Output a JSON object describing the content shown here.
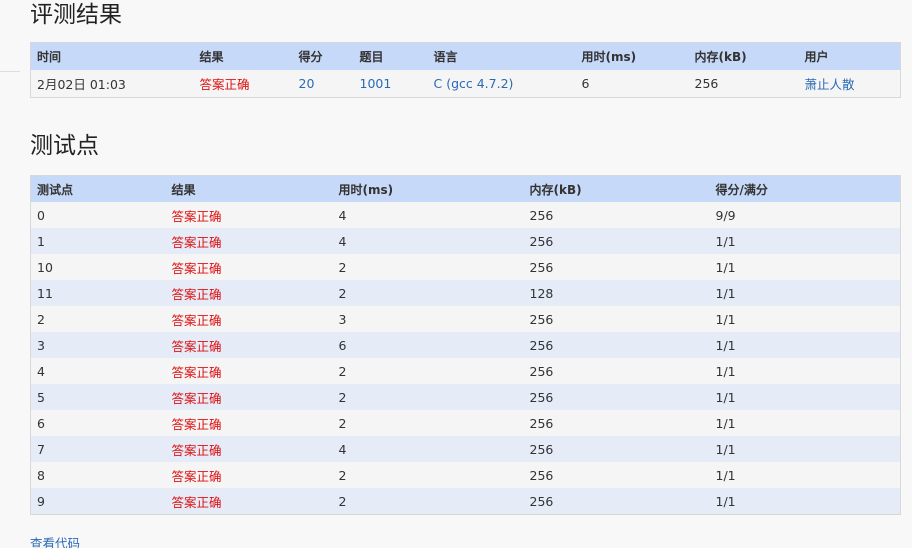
{
  "result_title": "评测结果",
  "summary": {
    "headers": [
      "时间",
      "结果",
      "得分",
      "题目",
      "语言",
      "用时(ms)",
      "内存(kB)",
      "用户"
    ],
    "row": {
      "time": "2月02日 01:03",
      "result": "答案正确",
      "score": "20",
      "problem": "1001",
      "language": "C (gcc 4.7.2)",
      "time_ms": "6",
      "memory_kb": "256",
      "user": "萧止人散"
    }
  },
  "cases_title": "测试点",
  "cases": {
    "headers": [
      "测试点",
      "结果",
      "用时(ms)",
      "内存(kB)",
      "得分/满分"
    ],
    "rows": [
      {
        "id": "0",
        "result": "答案正确",
        "time": "4",
        "memory": "256",
        "score": "9/9"
      },
      {
        "id": "1",
        "result": "答案正确",
        "time": "4",
        "memory": "256",
        "score": "1/1"
      },
      {
        "id": "10",
        "result": "答案正确",
        "time": "2",
        "memory": "256",
        "score": "1/1"
      },
      {
        "id": "11",
        "result": "答案正确",
        "time": "2",
        "memory": "128",
        "score": "1/1"
      },
      {
        "id": "2",
        "result": "答案正确",
        "time": "3",
        "memory": "256",
        "score": "1/1"
      },
      {
        "id": "3",
        "result": "答案正确",
        "time": "6",
        "memory": "256",
        "score": "1/1"
      },
      {
        "id": "4",
        "result": "答案正确",
        "time": "2",
        "memory": "256",
        "score": "1/1"
      },
      {
        "id": "5",
        "result": "答案正确",
        "time": "2",
        "memory": "256",
        "score": "1/1"
      },
      {
        "id": "6",
        "result": "答案正确",
        "time": "2",
        "memory": "256",
        "score": "1/1"
      },
      {
        "id": "7",
        "result": "答案正确",
        "time": "4",
        "memory": "256",
        "score": "1/1"
      },
      {
        "id": "8",
        "result": "答案正确",
        "time": "2",
        "memory": "256",
        "score": "1/1"
      },
      {
        "id": "9",
        "result": "答案正确",
        "time": "2",
        "memory": "256",
        "score": "1/1"
      }
    ]
  },
  "view_code_label": "查看代码",
  "colors": {
    "header_bg": "#c7d9f8",
    "accepted": "#dd1111",
    "link": "#2a6ab5",
    "row_odd": "#f5f5f5",
    "row_even": "#e5ecf8"
  }
}
